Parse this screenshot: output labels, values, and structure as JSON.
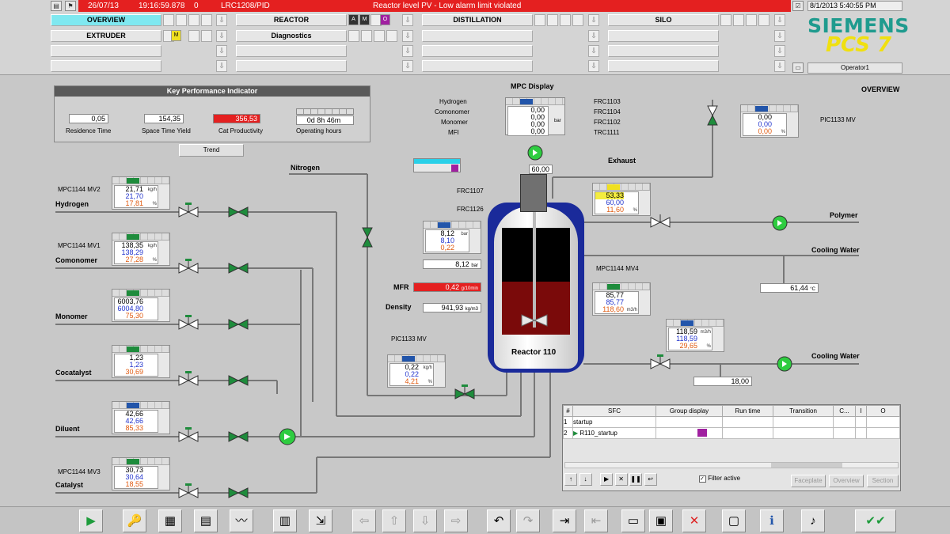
{
  "header": {
    "alarm": {
      "date": "26/07/13",
      "time": "19:16:59.878",
      "count": "0",
      "tag": "LRC1208/PID",
      "message": "Reactor level PV - Low alarm limit violated"
    },
    "datetime": "8/1/2013 5:40:55 PM",
    "operator": "Operator1",
    "brand": "SIEMENS",
    "product": "PCS 7",
    "areas": [
      {
        "label": "OVERVIEW"
      },
      {
        "label": "REACTOR"
      },
      {
        "label": "DISTILLATION"
      },
      {
        "label": "SILO"
      },
      {
        "label": "EXTRUDER"
      },
      {
        "label": "Diagnostics"
      }
    ]
  },
  "kpi": {
    "title": "Key Performance Indicator",
    "residence_time": {
      "value": "0,05",
      "label": "Residence Time"
    },
    "space_time_yield": {
      "value": "154,35",
      "label": "Space Time Yield"
    },
    "cat_productivity": {
      "value": "356,53",
      "label": "Cat Productivity"
    },
    "operating_hours": {
      "value": "0d  8h  46m",
      "label": "Operating hours"
    },
    "trend_button": "Trend"
  },
  "mpc": {
    "title": "MPC Display",
    "inputs": [
      "Hydrogen",
      "Comonomer",
      "Monomer",
      "MFI"
    ],
    "values": [
      "0,00",
      "0,00",
      "0,00",
      "0,00"
    ],
    "outputs": [
      "FRC1103",
      "FRC1104",
      "FRC1102",
      "TRC1111"
    ],
    "unit": "bar"
  },
  "feeds": [
    {
      "name": "Hydrogen",
      "mv": "MPC1144 MV2",
      "v1": "21,71",
      "v2": "21,70",
      "v3": "17,81",
      "u1": "kg/h",
      "u3": "%"
    },
    {
      "name": "Comonomer",
      "mv": "MPC1144 MV1",
      "v1": "138,35",
      "v2": "138,29",
      "v3": "27,28",
      "u1": "kg/h",
      "u3": "%"
    },
    {
      "name": "Monomer",
      "mv": "",
      "v1": "6003,76",
      "v2": "6004,80",
      "v3": "75,30",
      "u1": "",
      "u3": ""
    },
    {
      "name": "Cocatalyst",
      "mv": "",
      "v1": "1,23",
      "v2": "1,23",
      "v3": "30,69",
      "u1": "",
      "u3": ""
    },
    {
      "name": "Diluent",
      "mv": "",
      "v1": "42,66",
      "v2": "42,66",
      "v3": "85,33",
      "u1": "",
      "u3": ""
    },
    {
      "name": "Catalyst",
      "mv": "MPC1144 MV3",
      "v1": "30,73",
      "v2": "30,64",
      "v3": "18,55",
      "u1": "",
      "u3": ""
    }
  ],
  "reactor": {
    "name": "Reactor 110",
    "nitrogen": "Nitrogen",
    "exhaust": "Exhaust",
    "agitator_speed": "60,00",
    "frc1107": "FRC1107",
    "frc1126": "FRC1126",
    "fp_pressure": {
      "v1": "8,12",
      "v2": "8,10",
      "v3": "0,22",
      "unit": "bar"
    },
    "pressure_value": "8,12",
    "pressure_unit": "bar",
    "mfr": {
      "label": "MFR",
      "value": "0,42",
      "unit": "g/10min"
    },
    "density": {
      "label": "Density",
      "value": "941,93",
      "unit": "kg/m3"
    },
    "pic_left": {
      "label": "PIC1133 MV",
      "v1": "0,22",
      "v2": "0,22",
      "v3": "4,21",
      "unit": "kg/h",
      "u3": "%"
    },
    "level_fraction": 0.5
  },
  "right": {
    "pic_top": {
      "label": "PIC1133 MV",
      "v1": "0,00",
      "v2": "0,00",
      "v3": "0,00",
      "u3": "%"
    },
    "polymer_fp": {
      "v1": "53,33",
      "v2": "60,00",
      "v3": "11,60",
      "u3": "%"
    },
    "polymer": "Polymer",
    "cooling_water": "Cooling Water",
    "cw_temp": "61,44",
    "cw_unit": "°C",
    "mv4": {
      "label": "MPC1144 MV4",
      "v1": "85,77",
      "v2": "85,77",
      "v3": "118,60",
      "u3": "m3/h"
    },
    "cw2_fp": {
      "v1": "118,59",
      "v2": "118,59",
      "v3": "29,65",
      "u1": "m3/h",
      "u3": "%"
    },
    "cw2_value": "18,00",
    "overview_link": "OVERVIEW"
  },
  "sfc": {
    "headers": [
      "#",
      "SFC",
      "Group display",
      "Run time",
      "Transition",
      "C...",
      "I",
      "O"
    ],
    "rows": [
      {
        "num": "1",
        "name": "startup"
      },
      {
        "num": "2",
        "name": "R110_startup"
      }
    ],
    "filter_label": "Filter active",
    "buttons": [
      "Faceplate",
      "Overview",
      "Section"
    ]
  },
  "toolbar": {
    "icons": [
      "play-icon",
      "keys-icon",
      "folder-icon",
      "document-icon",
      "trend-icon",
      "thermometer-icon",
      "export-icon",
      "arrow-left-icon",
      "arrow-up-icon",
      "arrow-down-icon",
      "arrow-right-icon",
      "undo-icon",
      "redo-icon",
      "login-icon",
      "logout-icon",
      "print-preview-icon",
      "save-icon",
      "delete-icon",
      "monitor-icon",
      "info-icon",
      "audio-icon",
      "acknowledge-icon"
    ]
  }
}
